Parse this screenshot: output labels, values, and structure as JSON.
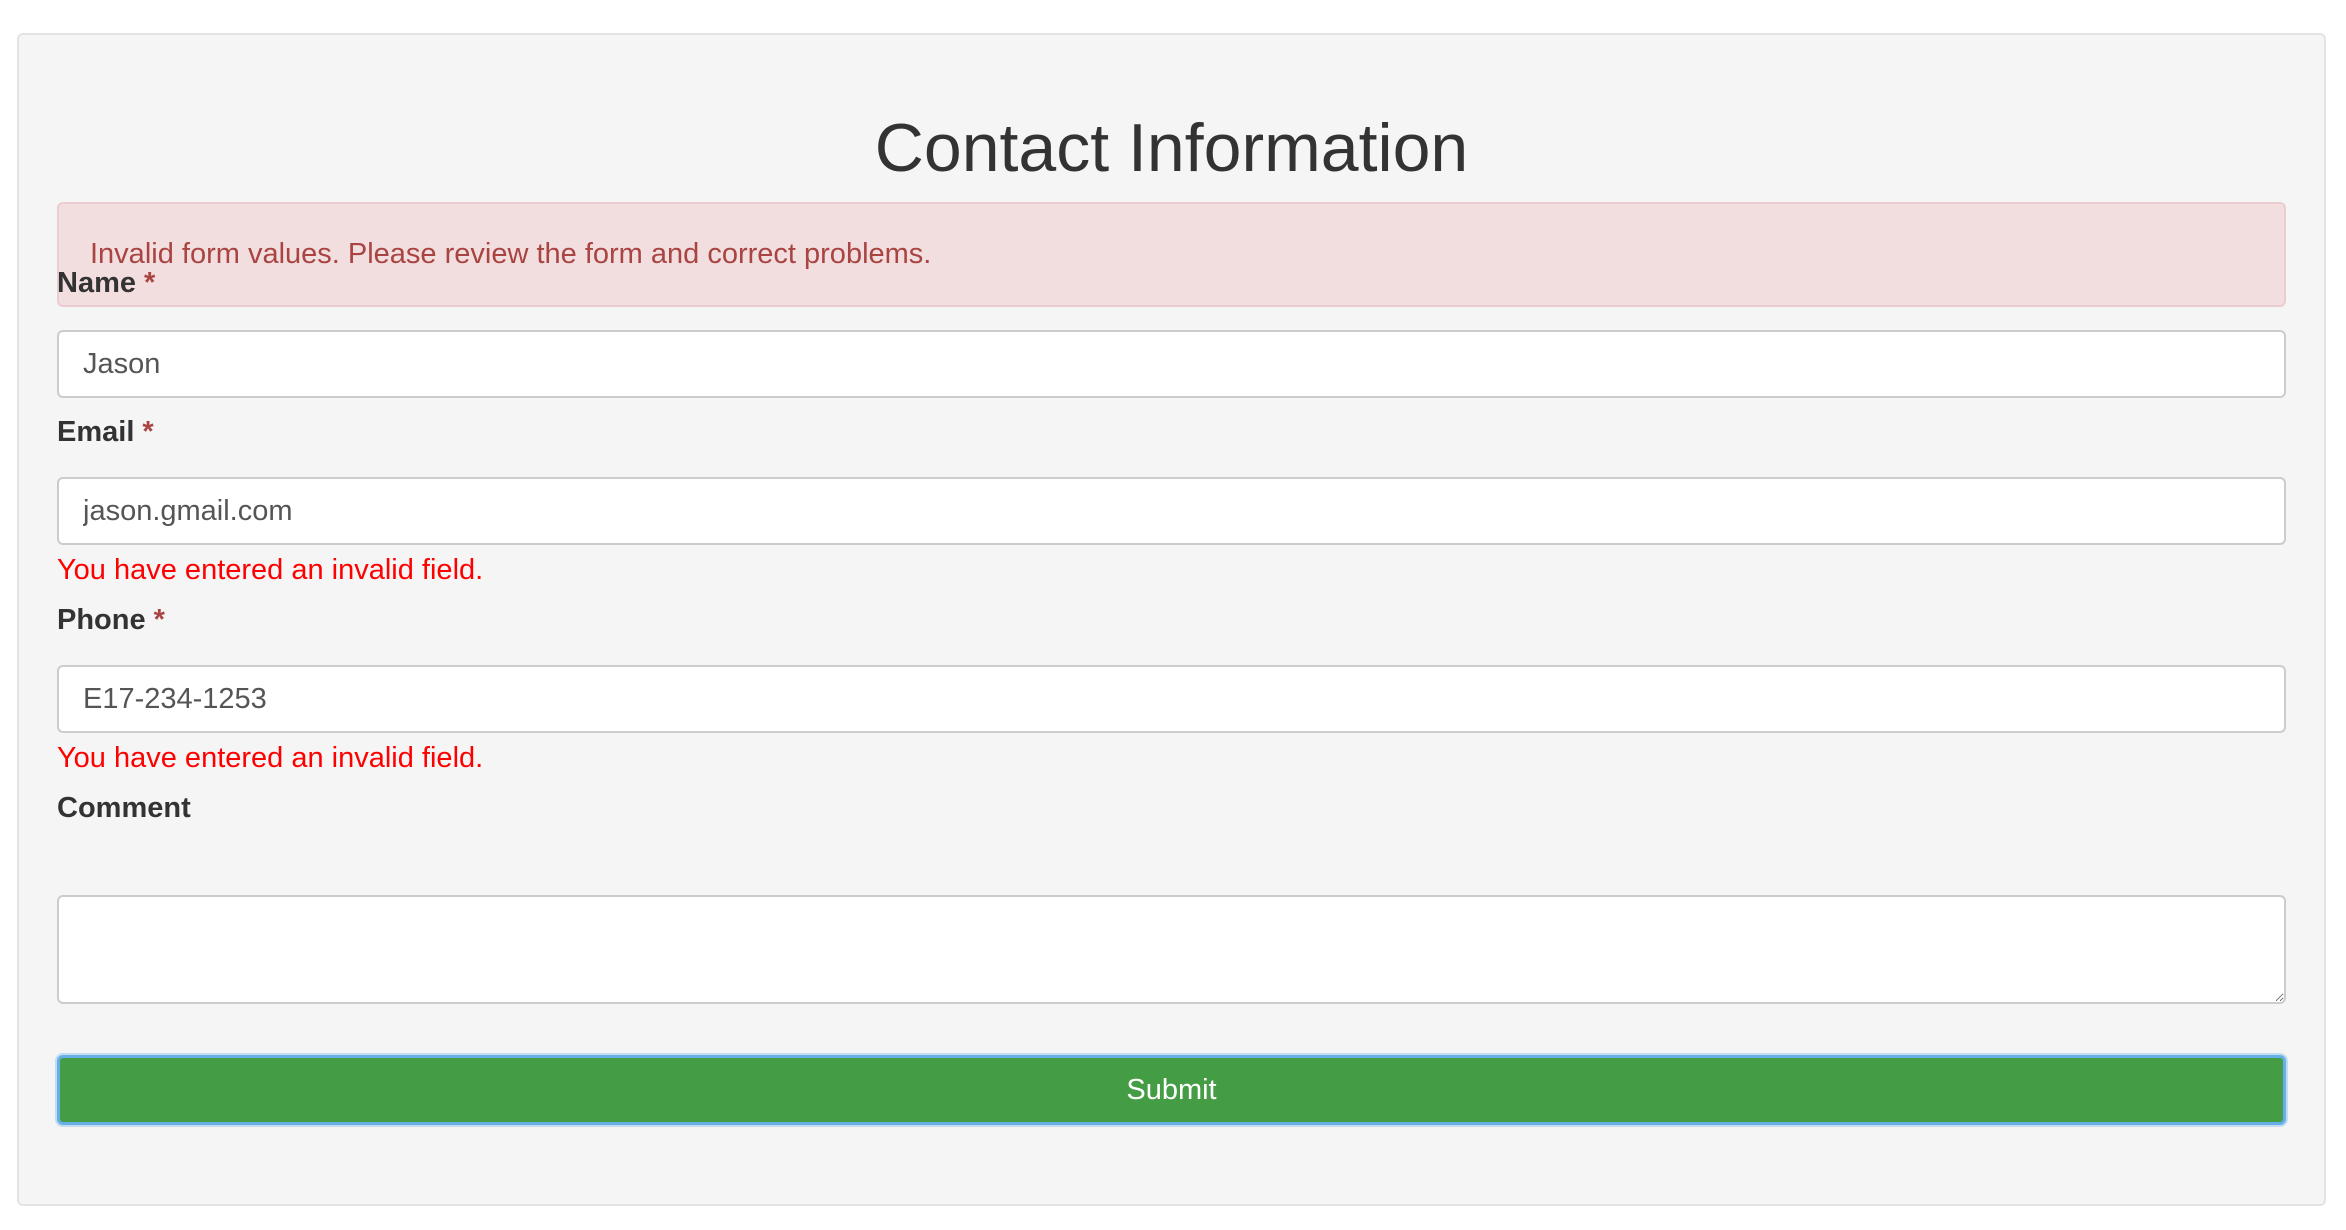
{
  "form": {
    "title": "Contact Information",
    "alert_message": "Invalid form values. Please review the form and correct problems.",
    "required_marker": "*",
    "fields": {
      "name": {
        "label": "Name",
        "value": "Jason"
      },
      "email": {
        "label": "Email",
        "value": "jason.gmail.com",
        "error": "You have entered an invalid field."
      },
      "phone": {
        "label": "Phone",
        "value": "E17-234-1253",
        "error": "You have entered an invalid field."
      },
      "comment": {
        "label": "Comment",
        "value": ""
      }
    },
    "submit_label": "Submit"
  },
  "colors": {
    "panel_bg": "#f5f5f5",
    "alert_bg": "#f2dede",
    "alert_text": "#a94442",
    "error_text": "#ff0000",
    "submit_bg": "#449d44",
    "focus_ring": "#66afe9"
  }
}
